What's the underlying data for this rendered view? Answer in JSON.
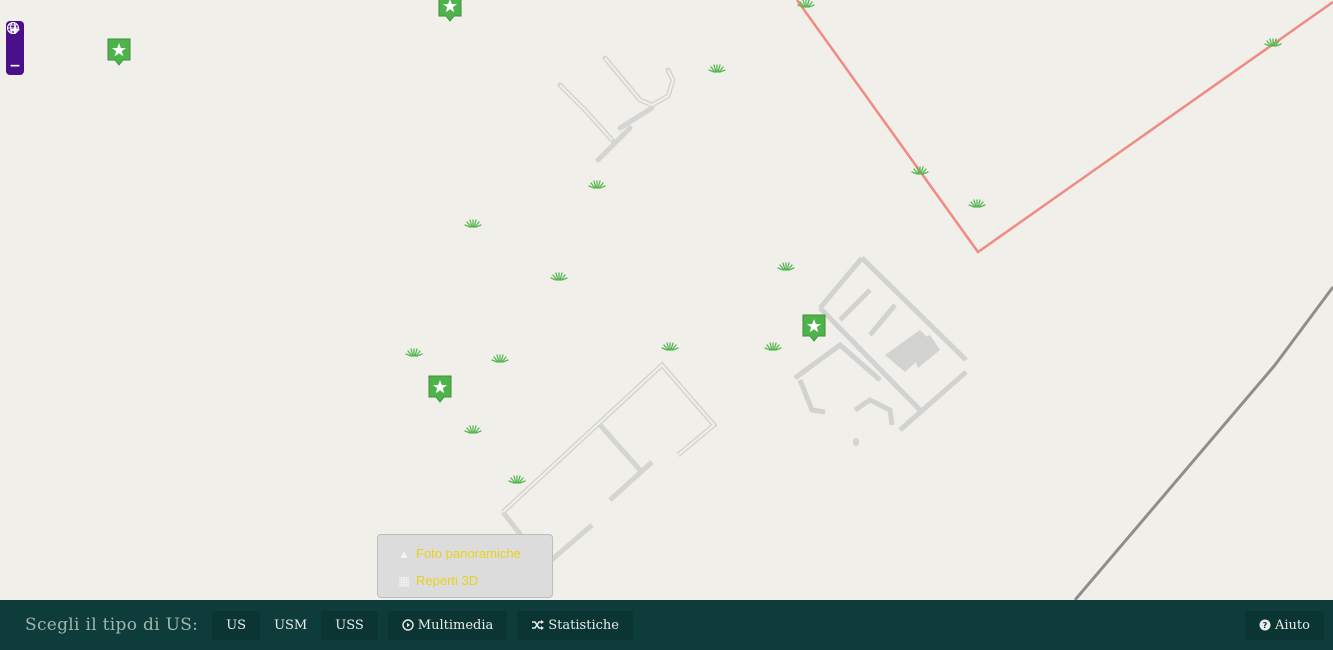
{
  "map": {
    "zoom_in_label": "+",
    "zoom_out_label": "−",
    "colors": {
      "background": "#f1efe9",
      "route_line": "#f08b82",
      "grey_road": "#8e8e8e",
      "marker_green": "#4fb34c",
      "ruins": "#d2d2d0"
    }
  },
  "bottom_bar": {
    "label": "Scegli il tipo di US:",
    "us_types": [
      "US",
      "USM",
      "USS"
    ],
    "multimedia_label": "Multimedia",
    "statistiche_label": "Statistiche",
    "help_label": "Aiuto"
  },
  "multimedia_menu": {
    "items": [
      {
        "label": "Foto panoramiche",
        "icon": "road-icon"
      },
      {
        "label": "Reperti 3D",
        "icon": "grid-icon"
      }
    ]
  }
}
